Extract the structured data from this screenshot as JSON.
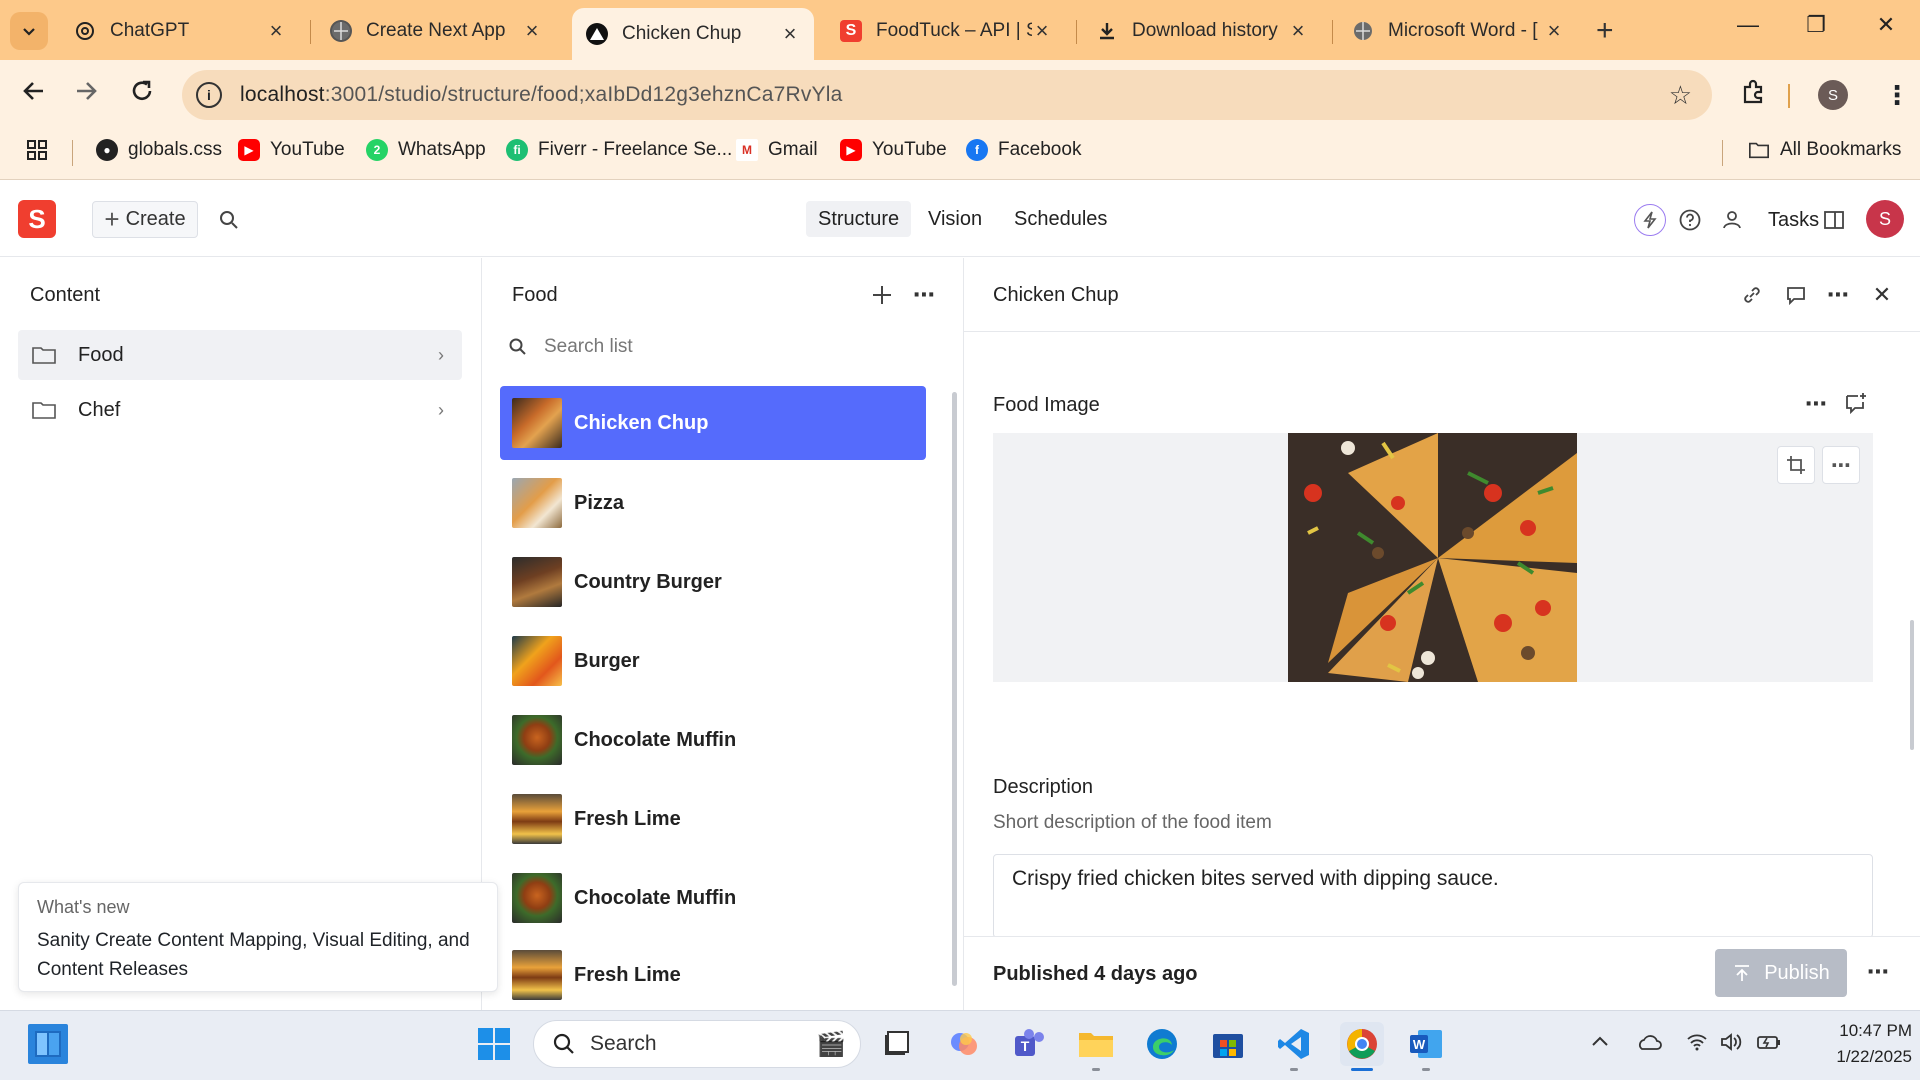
{
  "browser": {
    "tabs": [
      {
        "title": "ChatGPT",
        "icon": "chatgpt-icon",
        "active": false
      },
      {
        "title": "Create Next App",
        "icon": "globe-icon",
        "active": false
      },
      {
        "title": "Chicken Chup",
        "icon": "vercel-triangle-icon",
        "active": true
      },
      {
        "title": "FoodTuck – API | S",
        "icon": "sanity-icon",
        "active": false
      },
      {
        "title": "Download history",
        "icon": "download-icon",
        "active": false
      },
      {
        "title": "Microsoft Word - [",
        "icon": "globe-icon",
        "active": false
      }
    ],
    "url_host": "localhost",
    "url_path": ":3001/studio/structure/food;xaIbDd12g3ehznCa7RvYla",
    "profile_initial": "S",
    "bookmarks": [
      {
        "label": "globals.css",
        "icon": "github-icon"
      },
      {
        "label": "YouTube",
        "icon": "youtube-icon"
      },
      {
        "label": "WhatsApp",
        "icon": "whatsapp-icon"
      },
      {
        "label": "Fiverr - Freelance Se...",
        "icon": "fiverr-icon"
      },
      {
        "label": "Gmail",
        "icon": "gmail-icon"
      },
      {
        "label": "YouTube",
        "icon": "youtube-icon"
      },
      {
        "label": "Facebook",
        "icon": "facebook-icon"
      }
    ],
    "all_bookmarks": "All Bookmarks"
  },
  "studio": {
    "create_label": "Create",
    "nav": [
      "Structure",
      "Vision",
      "Schedules"
    ],
    "tasks_label": "Tasks",
    "user_initial": "S",
    "content_pane": {
      "title": "Content",
      "items": [
        "Food",
        "Chef"
      ]
    },
    "whats_new": {
      "kicker": "What's new",
      "text": "Sanity Create Content Mapping, Visual Editing, and Content Releases"
    },
    "food_pane": {
      "title": "Food",
      "search_placeholder": "Search list",
      "items": [
        "Chicken Chup",
        "Pizza",
        "Country Burger",
        "Burger",
        "Chocolate Muffin",
        "Fresh Lime",
        "Chocolate Muffin",
        "Fresh Lime"
      ]
    },
    "document": {
      "title": "Chicken Chup",
      "image_label": "Food Image",
      "description_label": "Description",
      "description_sub": "Short description of the food item",
      "description_value": "Crispy fried chicken bites served with dipping sauce.",
      "status": "Published 4 days ago",
      "publish_label": "Publish"
    }
  },
  "taskbar": {
    "search_label": "Search",
    "time": "10:47 PM",
    "date": "1/22/2025"
  },
  "colors": {
    "tabstrip": "#fdc98a",
    "toolbar": "#fef1e1",
    "selected_item": "#556bfc",
    "sanity_red": "#f03e2f"
  }
}
